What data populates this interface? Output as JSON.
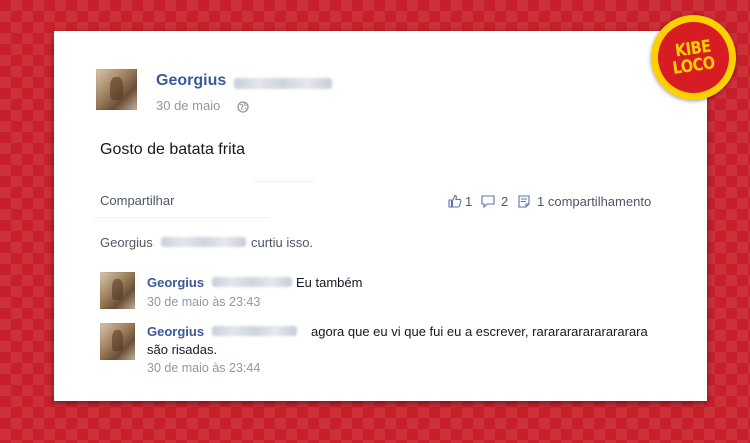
{
  "post": {
    "author_name": "Georgius",
    "date": "30 de maio",
    "audience_icon": "globe-icon",
    "text": "Gosto de batata frita"
  },
  "actions": {
    "share_label": "Compartilhar"
  },
  "stats": {
    "likes": "1",
    "comments": "2",
    "shares": "1 compartilhamento"
  },
  "likes_line": {
    "name": "Georgius",
    "suffix": "curtiu isso."
  },
  "comments": [
    {
      "author": "Georgius",
      "text": "Eu também",
      "time": "30 de maio às 23:43"
    },
    {
      "author": "Georgius",
      "text_line1": "agora que eu vi que fui eu a escrever, rararararararararara",
      "text_line2": "são risadas.",
      "time": "30 de maio às 23:44"
    }
  ],
  "badge": {
    "line1": "KIBE",
    "line2": "LOCO"
  },
  "colors": {
    "background": "#c8202a",
    "link": "#3b5998",
    "badge_yellow": "#ffd000",
    "badge_red": "#d81c24"
  }
}
